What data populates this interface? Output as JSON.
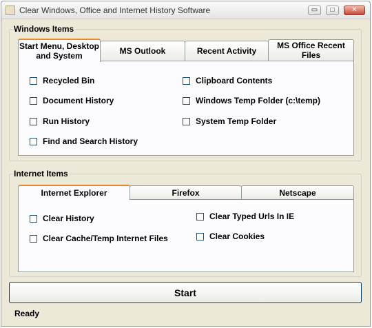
{
  "window": {
    "title": "Clear Windows, Office and Internet History Software",
    "controls": {
      "minimize": "▭",
      "maximize": "□",
      "close": "✕"
    }
  },
  "windows_items": {
    "label": "Windows Items",
    "tabs": [
      {
        "label": "Start Menu, Desktop and System",
        "active": true
      },
      {
        "label": "MS Outlook"
      },
      {
        "label": "Recent Activity"
      },
      {
        "label": "MS Office Recent Files"
      }
    ],
    "checkboxes_left": [
      "Recycled Bin",
      "Document History",
      "Run History",
      "Find and Search History"
    ],
    "checkboxes_right": [
      "Clipboard Contents",
      "Windows Temp Folder (c:\\temp)",
      "System Temp Folder"
    ]
  },
  "internet_items": {
    "label": "Internet Items",
    "tabs": [
      {
        "label": "Internet Explorer",
        "active": true
      },
      {
        "label": "Firefox"
      },
      {
        "label": "Netscape"
      }
    ],
    "checkboxes_left": [
      "Clear History",
      "Clear Cache/Temp Internet Files"
    ],
    "checkboxes_right": [
      "Clear Typed Urls In IE",
      "Clear Cookies"
    ]
  },
  "start_button": "Start",
  "status": "Ready"
}
